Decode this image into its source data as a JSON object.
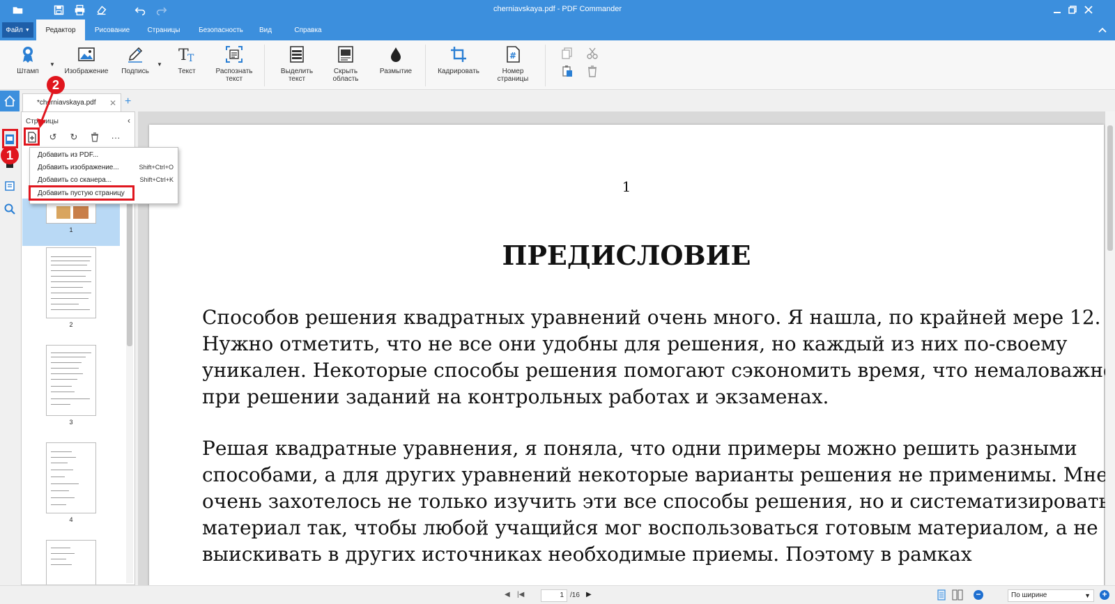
{
  "window": {
    "title": "cherniavskaya.pdf - PDF Commander"
  },
  "menu": {
    "file": "Файл",
    "tabs": [
      "Редактор",
      "Рисование",
      "Страницы",
      "Безопасность",
      "Вид",
      "Справка"
    ]
  },
  "ribbon": {
    "stamp": "Штамп",
    "image": "Изображение",
    "signature": "Подпись",
    "text": "Текст",
    "ocr": [
      "Распознать",
      "текст"
    ],
    "highlight": [
      "Выделить",
      "текст"
    ],
    "hide_area": [
      "Скрыть",
      "область"
    ],
    "blur": "Размытие",
    "crop": "Кадрировать",
    "page_number": [
      "Номер",
      "страницы"
    ]
  },
  "tab": {
    "name": "*cherniavskaya.pdf"
  },
  "panel": {
    "title": "Страницы",
    "thumbnails": [
      "1",
      "2",
      "3",
      "4"
    ]
  },
  "dropdown": {
    "items": [
      {
        "label": "Добавить из PDF...",
        "shortcut": ""
      },
      {
        "label": "Добавить изображение...",
        "shortcut": "Shift+Ctrl+O"
      },
      {
        "label": "Добавить со сканера...",
        "shortcut": "Shift+Ctrl+K"
      },
      {
        "label": "Добавить пустую страницу",
        "shortcut": ""
      }
    ]
  },
  "document": {
    "page_number": "1",
    "heading": "ПРЕДИСЛОВИЕ",
    "para1": [
      "Способов решения квадратных уравнений очень много. Я нашла, по крайней мере 12.",
      "Нужно отметить, что не все они удобны для решения, но каждый из них по-своему",
      "уникален. Некоторые способы решения помогают сэкономить время, что немаловажно",
      "при решении заданий на контрольных работах и экзаменах."
    ],
    "para2": [
      "Решая квадратные уравнения, я поняла, что одни примеры можно решить разными",
      "способами, а для других уравнений некоторые варианты решения не применимы. Мне",
      "очень захотелось не только изучить эти все способы решения, но и систематизировать",
      "материал так, чтобы любой учащийся  мог воспользоваться готовым материалом, а не",
      "выискивать в других источниках необходимые приемы. Поэтому в рамках"
    ]
  },
  "status": {
    "current_page": "1",
    "total_pages": "/16",
    "zoom": "По ширине"
  },
  "annotations": {
    "badge1": "1",
    "badge2": "2"
  },
  "colors": {
    "accent": "#3c8fdd",
    "highlight": "#e0161e",
    "selected_thumb": "#b9d9f5"
  }
}
